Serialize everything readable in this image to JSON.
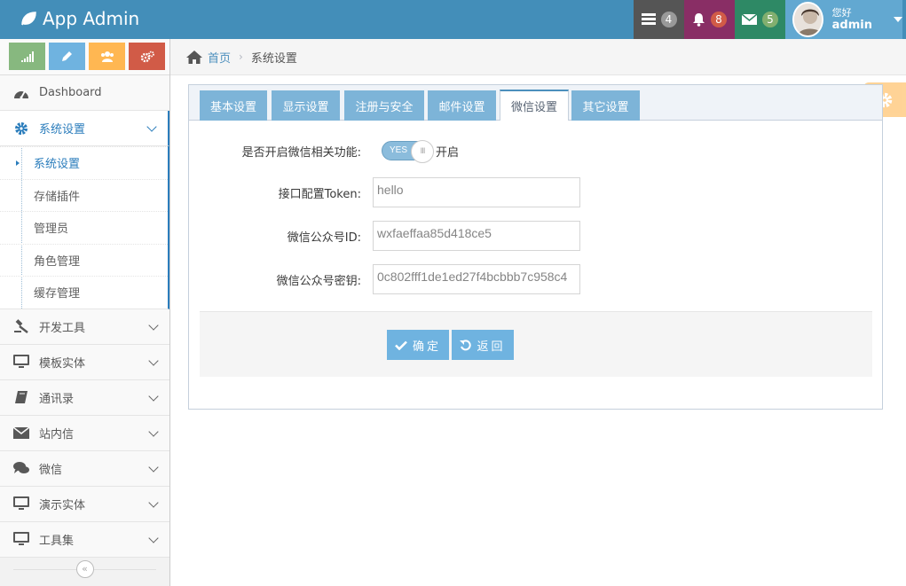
{
  "app": {
    "title": "App Admin"
  },
  "navbar": {
    "tasks_count": "4",
    "notifications_count": "8",
    "messages_count": "5",
    "user_greeting": "您好",
    "user_name": "admin"
  },
  "sidebar": {
    "shortcuts": [
      "signal-icon",
      "pencil-icon",
      "users-icon",
      "cogs-icon"
    ],
    "items": [
      {
        "label": "Dashboard",
        "icon": "dashboard-icon"
      },
      {
        "label": "系统设置",
        "icon": "gear-icon",
        "active": true
      },
      {
        "label": "开发工具",
        "icon": "gavel-icon"
      },
      {
        "label": "模板实体",
        "icon": "desktop-icon"
      },
      {
        "label": "通讯录",
        "icon": "book-icon"
      },
      {
        "label": "站内信",
        "icon": "envelope-icon"
      },
      {
        "label": "微信",
        "icon": "comments-icon"
      },
      {
        "label": "演示实体",
        "icon": "desktop-icon"
      },
      {
        "label": "工具集",
        "icon": "desktop-icon"
      }
    ],
    "submenu": [
      "系统设置",
      "存储插件",
      "管理员",
      "角色管理",
      "缓存管理"
    ]
  },
  "breadcrumb": {
    "home": "首页",
    "current": "系统设置"
  },
  "tabs": [
    "基本设置",
    "显示设置",
    "注册与安全",
    "邮件设置",
    "微信设置",
    "其它设置"
  ],
  "active_tab": "微信设置",
  "form": {
    "enable_label": "是否开启微信相关功能:",
    "enable_toggle_text": "YES",
    "enable_state_text": "开启",
    "token_label": "接口配置Token:",
    "token_value": "hello",
    "appid_label": "微信公众号ID:",
    "appid_value": "wxfaeffaa85d418ce5",
    "secret_label": "微信公众号密钥:",
    "secret_value": "0c802fff1de1ed27f4bcbbb7c958c4"
  },
  "actions": {
    "confirm_label": "确定",
    "back_label": "返回"
  },
  "colors": {
    "navbar": "#438eb9",
    "accent": "#6fb3e0",
    "active_link": "#2b7dbc"
  }
}
